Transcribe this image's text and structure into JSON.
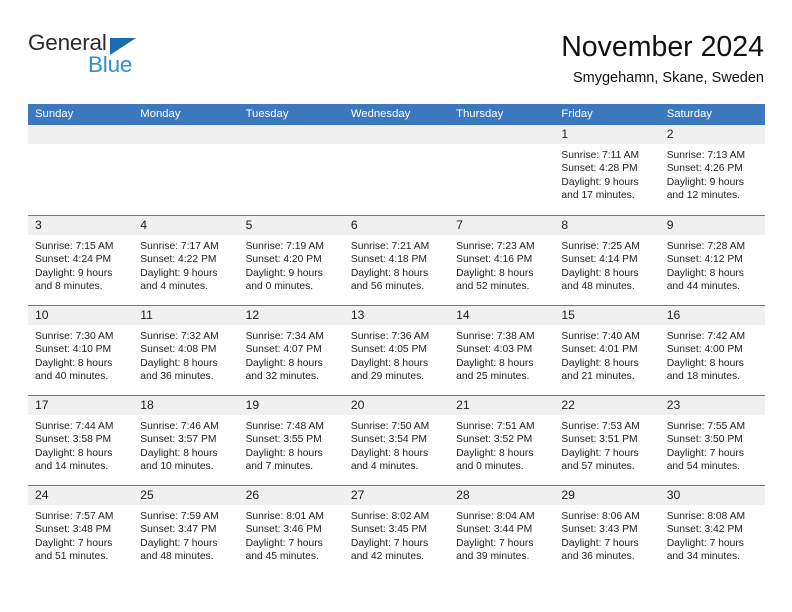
{
  "brand": {
    "name_top": "General",
    "name_bottom": "Blue",
    "color_dark": "#2b2b2b",
    "color_blue": "#2d8fd5",
    "triangle_color": "#1c6cb5"
  },
  "header": {
    "title": "November 2024",
    "subtitle": "Smygehamn, Skane, Sweden"
  },
  "theme": {
    "header_row_bg": "#3b78bd",
    "header_row_text": "#ffffff",
    "day_band_bg": "#f0f0f0",
    "week_divider": "#4a7fbd"
  },
  "calendar": {
    "weekdays": [
      "Sunday",
      "Monday",
      "Tuesday",
      "Wednesday",
      "Thursday",
      "Friday",
      "Saturday"
    ],
    "weeks": [
      [
        {
          "day": "",
          "empty": true
        },
        {
          "day": "",
          "empty": true
        },
        {
          "day": "",
          "empty": true
        },
        {
          "day": "",
          "empty": true
        },
        {
          "day": "",
          "empty": true
        },
        {
          "day": "1",
          "sunrise": "Sunrise: 7:11 AM",
          "sunset": "Sunset: 4:28 PM",
          "daylight_1": "Daylight: 9 hours",
          "daylight_2": "and 17 minutes."
        },
        {
          "day": "2",
          "sunrise": "Sunrise: 7:13 AM",
          "sunset": "Sunset: 4:26 PM",
          "daylight_1": "Daylight: 9 hours",
          "daylight_2": "and 12 minutes."
        }
      ],
      [
        {
          "day": "3",
          "sunrise": "Sunrise: 7:15 AM",
          "sunset": "Sunset: 4:24 PM",
          "daylight_1": "Daylight: 9 hours",
          "daylight_2": "and 8 minutes."
        },
        {
          "day": "4",
          "sunrise": "Sunrise: 7:17 AM",
          "sunset": "Sunset: 4:22 PM",
          "daylight_1": "Daylight: 9 hours",
          "daylight_2": "and 4 minutes."
        },
        {
          "day": "5",
          "sunrise": "Sunrise: 7:19 AM",
          "sunset": "Sunset: 4:20 PM",
          "daylight_1": "Daylight: 9 hours",
          "daylight_2": "and 0 minutes."
        },
        {
          "day": "6",
          "sunrise": "Sunrise: 7:21 AM",
          "sunset": "Sunset: 4:18 PM",
          "daylight_1": "Daylight: 8 hours",
          "daylight_2": "and 56 minutes."
        },
        {
          "day": "7",
          "sunrise": "Sunrise: 7:23 AM",
          "sunset": "Sunset: 4:16 PM",
          "daylight_1": "Daylight: 8 hours",
          "daylight_2": "and 52 minutes."
        },
        {
          "day": "8",
          "sunrise": "Sunrise: 7:25 AM",
          "sunset": "Sunset: 4:14 PM",
          "daylight_1": "Daylight: 8 hours",
          "daylight_2": "and 48 minutes."
        },
        {
          "day": "9",
          "sunrise": "Sunrise: 7:28 AM",
          "sunset": "Sunset: 4:12 PM",
          "daylight_1": "Daylight: 8 hours",
          "daylight_2": "and 44 minutes."
        }
      ],
      [
        {
          "day": "10",
          "sunrise": "Sunrise: 7:30 AM",
          "sunset": "Sunset: 4:10 PM",
          "daylight_1": "Daylight: 8 hours",
          "daylight_2": "and 40 minutes."
        },
        {
          "day": "11",
          "sunrise": "Sunrise: 7:32 AM",
          "sunset": "Sunset: 4:08 PM",
          "daylight_1": "Daylight: 8 hours",
          "daylight_2": "and 36 minutes."
        },
        {
          "day": "12",
          "sunrise": "Sunrise: 7:34 AM",
          "sunset": "Sunset: 4:07 PM",
          "daylight_1": "Daylight: 8 hours",
          "daylight_2": "and 32 minutes."
        },
        {
          "day": "13",
          "sunrise": "Sunrise: 7:36 AM",
          "sunset": "Sunset: 4:05 PM",
          "daylight_1": "Daylight: 8 hours",
          "daylight_2": "and 29 minutes."
        },
        {
          "day": "14",
          "sunrise": "Sunrise: 7:38 AM",
          "sunset": "Sunset: 4:03 PM",
          "daylight_1": "Daylight: 8 hours",
          "daylight_2": "and 25 minutes."
        },
        {
          "day": "15",
          "sunrise": "Sunrise: 7:40 AM",
          "sunset": "Sunset: 4:01 PM",
          "daylight_1": "Daylight: 8 hours",
          "daylight_2": "and 21 minutes."
        },
        {
          "day": "16",
          "sunrise": "Sunrise: 7:42 AM",
          "sunset": "Sunset: 4:00 PM",
          "daylight_1": "Daylight: 8 hours",
          "daylight_2": "and 18 minutes."
        }
      ],
      [
        {
          "day": "17",
          "sunrise": "Sunrise: 7:44 AM",
          "sunset": "Sunset: 3:58 PM",
          "daylight_1": "Daylight: 8 hours",
          "daylight_2": "and 14 minutes."
        },
        {
          "day": "18",
          "sunrise": "Sunrise: 7:46 AM",
          "sunset": "Sunset: 3:57 PM",
          "daylight_1": "Daylight: 8 hours",
          "daylight_2": "and 10 minutes."
        },
        {
          "day": "19",
          "sunrise": "Sunrise: 7:48 AM",
          "sunset": "Sunset: 3:55 PM",
          "daylight_1": "Daylight: 8 hours",
          "daylight_2": "and 7 minutes."
        },
        {
          "day": "20",
          "sunrise": "Sunrise: 7:50 AM",
          "sunset": "Sunset: 3:54 PM",
          "daylight_1": "Daylight: 8 hours",
          "daylight_2": "and 4 minutes."
        },
        {
          "day": "21",
          "sunrise": "Sunrise: 7:51 AM",
          "sunset": "Sunset: 3:52 PM",
          "daylight_1": "Daylight: 8 hours",
          "daylight_2": "and 0 minutes."
        },
        {
          "day": "22",
          "sunrise": "Sunrise: 7:53 AM",
          "sunset": "Sunset: 3:51 PM",
          "daylight_1": "Daylight: 7 hours",
          "daylight_2": "and 57 minutes."
        },
        {
          "day": "23",
          "sunrise": "Sunrise: 7:55 AM",
          "sunset": "Sunset: 3:50 PM",
          "daylight_1": "Daylight: 7 hours",
          "daylight_2": "and 54 minutes."
        }
      ],
      [
        {
          "day": "24",
          "sunrise": "Sunrise: 7:57 AM",
          "sunset": "Sunset: 3:48 PM",
          "daylight_1": "Daylight: 7 hours",
          "daylight_2": "and 51 minutes."
        },
        {
          "day": "25",
          "sunrise": "Sunrise: 7:59 AM",
          "sunset": "Sunset: 3:47 PM",
          "daylight_1": "Daylight: 7 hours",
          "daylight_2": "and 48 minutes."
        },
        {
          "day": "26",
          "sunrise": "Sunrise: 8:01 AM",
          "sunset": "Sunset: 3:46 PM",
          "daylight_1": "Daylight: 7 hours",
          "daylight_2": "and 45 minutes."
        },
        {
          "day": "27",
          "sunrise": "Sunrise: 8:02 AM",
          "sunset": "Sunset: 3:45 PM",
          "daylight_1": "Daylight: 7 hours",
          "daylight_2": "and 42 minutes."
        },
        {
          "day": "28",
          "sunrise": "Sunrise: 8:04 AM",
          "sunset": "Sunset: 3:44 PM",
          "daylight_1": "Daylight: 7 hours",
          "daylight_2": "and 39 minutes."
        },
        {
          "day": "29",
          "sunrise": "Sunrise: 8:06 AM",
          "sunset": "Sunset: 3:43 PM",
          "daylight_1": "Daylight: 7 hours",
          "daylight_2": "and 36 minutes."
        },
        {
          "day": "30",
          "sunrise": "Sunrise: 8:08 AM",
          "sunset": "Sunset: 3:42 PM",
          "daylight_1": "Daylight: 7 hours",
          "daylight_2": "and 34 minutes."
        }
      ]
    ]
  }
}
